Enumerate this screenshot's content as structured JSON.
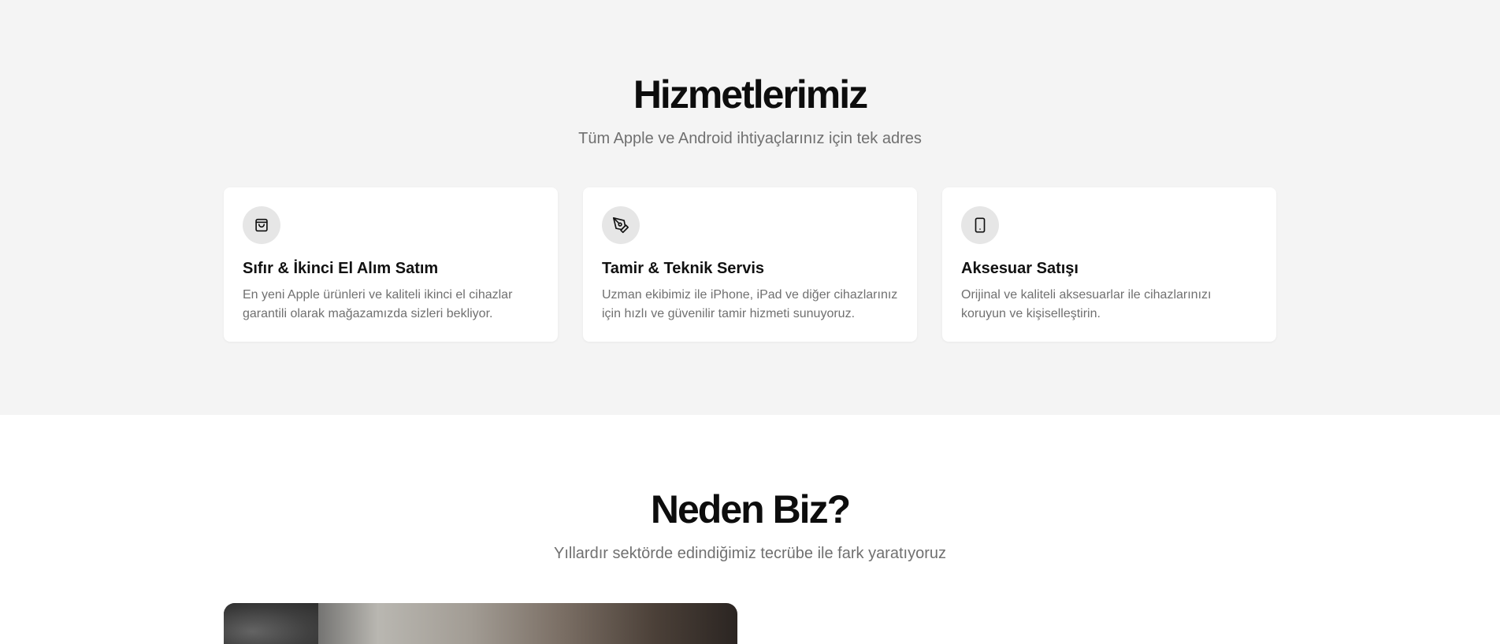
{
  "services": {
    "title": "Hizmetlerimiz",
    "subtitle": "Tüm Apple ve Android ihtiyaçlarınız için tek adres",
    "cards": [
      {
        "icon": "shopping-bag-icon",
        "title": "Sıfır & İkinci El Alım Satım",
        "text_line1": "En yeni Apple ürünleri ve kaliteli ikinci el cihazlar",
        "text_line2": "garantili olarak mağazamızda sizleri bekliyor."
      },
      {
        "icon": "pen-tool-icon",
        "title": "Tamir & Teknik Servis",
        "text_line1": "Uzman ekibimiz ile iPhone, iPad ve diğer cihazlarınız",
        "text_line2": "için hızlı ve güvenilir tamir hizmeti sunuyoruz."
      },
      {
        "icon": "smartphone-icon",
        "title": "Aksesuar Satışı",
        "text_line1": "Orijinal ve kaliteli aksesuarlar ile cihazlarınızı",
        "text_line2": "koruyun ve kişiselleştirin."
      }
    ]
  },
  "why": {
    "title": "Neden Biz?",
    "subtitle": "Yıllardır sektörde edindiğimiz tecrübe ile fark yaratıyoruz"
  },
  "colors": {
    "section_bg": "#f4f4f4",
    "card_bg": "#ffffff",
    "icon_bg": "#e6e6e6",
    "muted_text": "#707070",
    "heading_text": "#0d0d0d"
  }
}
